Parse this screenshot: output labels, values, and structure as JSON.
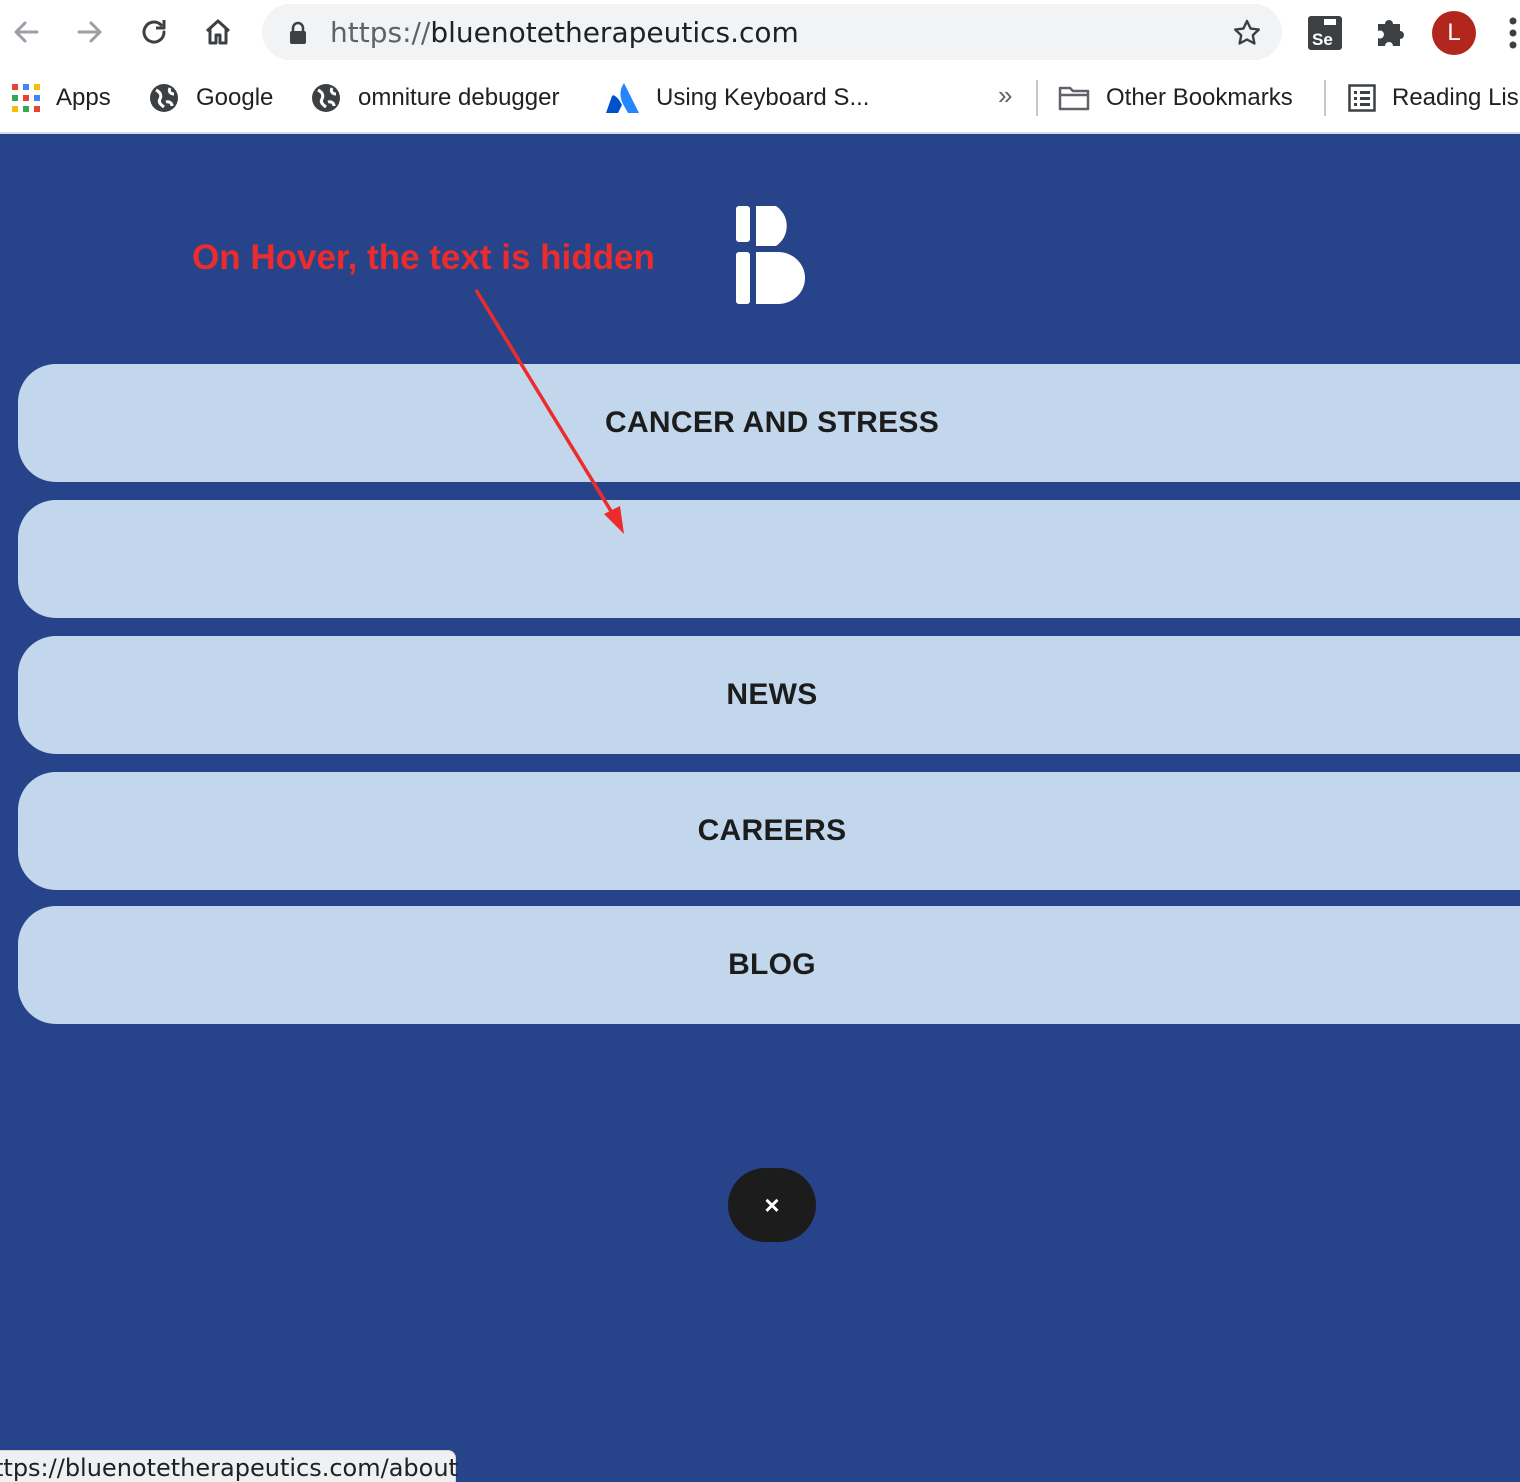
{
  "browser": {
    "url_scheme": "https://",
    "url_host": "bluenotetherapeutics.com",
    "profile_initial": "L",
    "extension_label": "Se",
    "bookmarks": [
      {
        "label": "Apps",
        "icon": "apps-grid-icon"
      },
      {
        "label": "Google",
        "icon": "globe-icon"
      },
      {
        "label": "omniture debugger",
        "icon": "globe-icon"
      },
      {
        "label": "Using Keyboard S...",
        "icon": "atlassian-icon"
      }
    ],
    "overflow_label": "»",
    "other_bookmarks": "Other Bookmarks",
    "reading_list": "Reading Lis",
    "status_url": "ttps://bluenotetherapeutics.com/about"
  },
  "annotation": {
    "text": "On Hover, the text is hidden",
    "color": "#ec2c2c"
  },
  "menu": {
    "items": [
      {
        "label": "CANCER AND STRESS",
        "hovered": false
      },
      {
        "label": "",
        "hovered": true
      },
      {
        "label": "NEWS",
        "hovered": false
      },
      {
        "label": "CAREERS",
        "hovered": false
      },
      {
        "label": "BLOG",
        "hovered": false
      }
    ],
    "close_label": "×"
  },
  "colors": {
    "page_background": "#27448a",
    "menu_item_background": "#c2d6ec",
    "close_button_background": "#1c1c1c"
  }
}
